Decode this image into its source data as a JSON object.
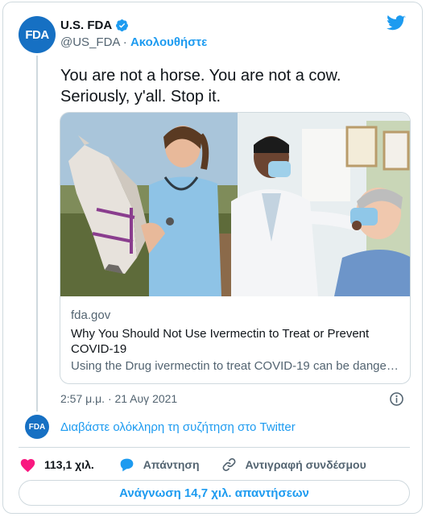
{
  "author": {
    "name": "U.S. FDA",
    "handle": "@US_FDA",
    "separator": " · ",
    "follow_label": "Ακολουθήστε",
    "avatar_text": "FDA"
  },
  "tweet": {
    "text": "You are not a horse. You are not a cow. Seriously, y'all. Stop it.",
    "timestamp": "2:57 μ.μ. · 21 Αυγ 2021"
  },
  "link_card": {
    "domain": "fda.gov",
    "title": "Why You Should Not Use Ivermectin to Treat or Prevent COVID-19",
    "description": "Using the Drug ivermectin to treat COVID-19 can be dangerous and even lethal."
  },
  "thread": {
    "avatar_text": "FDA",
    "link_label": "Διαβάστε ολόκληρη τη συζήτηση στο Twitter"
  },
  "actions": {
    "like_count": "113,1 χιλ.",
    "reply_label": "Απάντηση",
    "copy_link_label": "Αντιγραφή συνδέσμου"
  },
  "read_replies_label": "Ανάγνωση 14,7 χιλ. απαντήσεων",
  "colors": {
    "accent": "#1d9bf0",
    "like": "#f91880",
    "fda_blue": "#1670c3",
    "muted": "#536471",
    "border": "#cfd9de"
  },
  "icons": [
    "verified-badge-icon",
    "twitter-bird-icon",
    "info-icon",
    "heart-icon",
    "reply-bubble-icon",
    "link-icon"
  ]
}
